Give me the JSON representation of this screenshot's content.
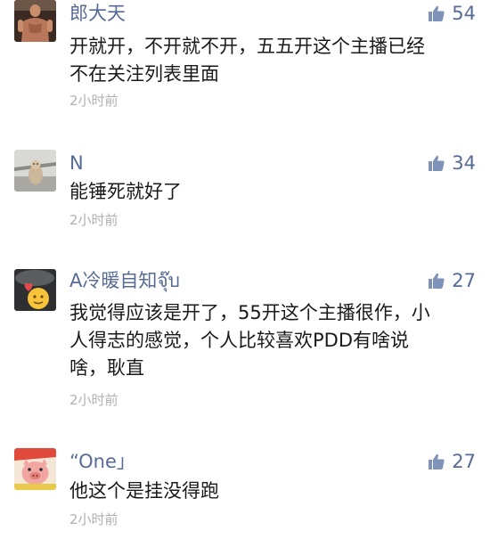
{
  "comments": [
    {
      "username": "郎大天",
      "like_count": "54",
      "text": "开就开，不开就不开，五五开这个主播已经\n不在关注列表里面",
      "time": "2小时前",
      "avatar_icon": "muscle-man-avatar-icon"
    },
    {
      "username": "N",
      "like_count": "34",
      "text": "能锤死就好了",
      "time": "2小时前",
      "avatar_icon": "dog-photo-avatar-icon"
    },
    {
      "username": "A冷暖自知จุ๊บ",
      "like_count": "27",
      "text": "我觉得应该是开了，55开这个主播很作，小\n人得志的感觉，个人比较喜欢PDD有啥说\n啥，耿直",
      "time": "2小时前",
      "avatar_icon": "heart-emoji-avatar-icon"
    },
    {
      "username": "“One」",
      "like_count": "27",
      "text": "他这个是挂没得跑",
      "time": "2小时前",
      "avatar_icon": "cartoon-pig-avatar-icon"
    }
  ],
  "colors": {
    "username": "#576b95",
    "like_icon": "#7f92b8",
    "text": "#1a1a1a",
    "time": "#b0b0b0"
  }
}
